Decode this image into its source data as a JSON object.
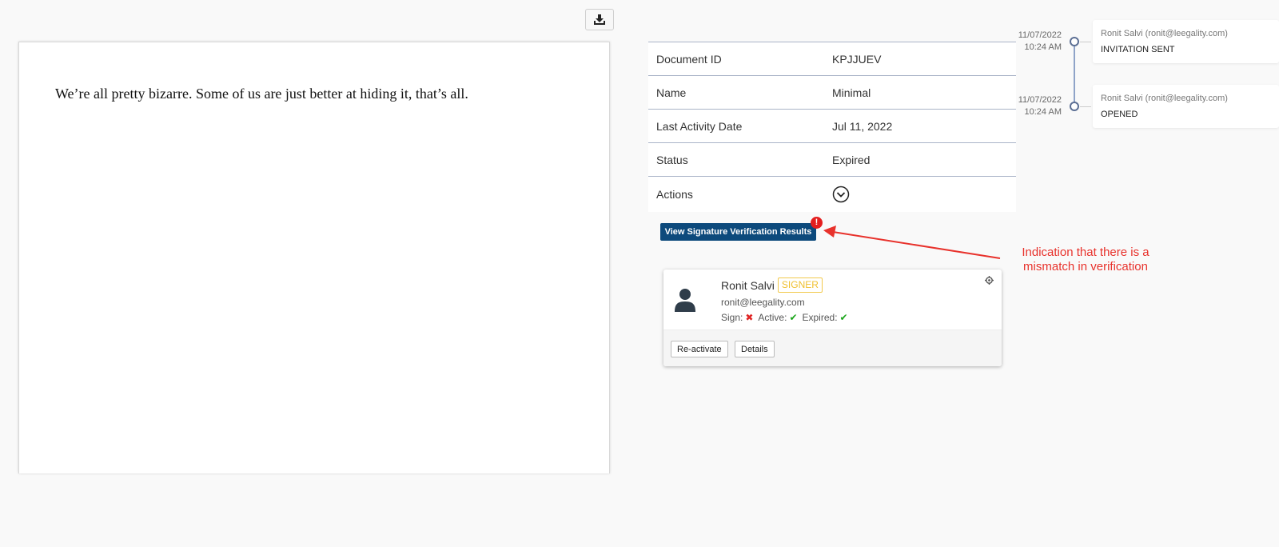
{
  "document": {
    "text": "We’re all pretty bizarre. Some of us are just better at hiding it, that’s all."
  },
  "toolbar": {
    "download_icon": "download-icon"
  },
  "details": {
    "rows": [
      {
        "label": "Document ID",
        "value": "KPJJUEV"
      },
      {
        "label": "Name",
        "value": "Minimal"
      },
      {
        "label": "Last Activity Date",
        "value": "Jul 11, 2022"
      },
      {
        "label": "Status",
        "value": "Expired"
      },
      {
        "label": "Actions",
        "value": ""
      }
    ],
    "actions_icon": "chevron-down-circle-icon"
  },
  "verification": {
    "button_label": "View Signature Verification Results",
    "alert_badge": "!",
    "annotation": "Indication that there is a mismatch in verification"
  },
  "signer": {
    "name": "Ronit Salvi",
    "role": "SIGNER",
    "email": "ronit@leegality.com",
    "sign_label": "Sign:",
    "sign_icon": "✖",
    "active_label": "Active:",
    "active_icon": "✔",
    "expired_label": "Expired:",
    "expired_icon": "✔",
    "reactivate_label": "Re-activate",
    "details_label": "Details"
  },
  "timeline": [
    {
      "date": "11/07/2022",
      "time": "10:24 AM",
      "actor": "Ronit Salvi (ronit@leegality.com)",
      "event": "INVITATION SENT"
    },
    {
      "date": "11/07/2022",
      "time": "10:24 AM",
      "actor": "Ronit Salvi (ronit@leegality.com)",
      "event": "OPENED"
    }
  ],
  "colors": {
    "primary_button": "#0d4a7c",
    "alert": "#e41e1e",
    "annotation": "#e8322c",
    "signer_badge": "#f0c030",
    "success": "#1aa51a"
  }
}
